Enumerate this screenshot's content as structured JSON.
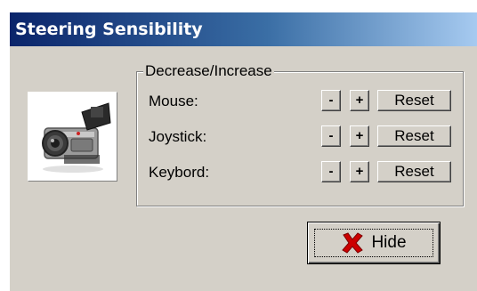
{
  "window": {
    "title": "Steering Sensibility"
  },
  "group": {
    "legend": "Decrease/Increase"
  },
  "rows": [
    {
      "label": "Mouse:",
      "decrease_label": "-",
      "increase_label": "+",
      "reset_label": "Reset"
    },
    {
      "label": "Joystick:",
      "decrease_label": "-",
      "increase_label": "+",
      "reset_label": "Reset"
    },
    {
      "label": "Keybord:",
      "decrease_label": "-",
      "increase_label": "+",
      "reset_label": "Reset"
    }
  ],
  "hide_button": {
    "label": "Hide",
    "icon": "red-x-icon"
  },
  "image": {
    "icon": "camcorder-icon"
  },
  "colors": {
    "title_start": "#0a246a",
    "title_end": "#a6caf0",
    "face": "#d4d0c8",
    "x_icon": "#cc0000"
  }
}
